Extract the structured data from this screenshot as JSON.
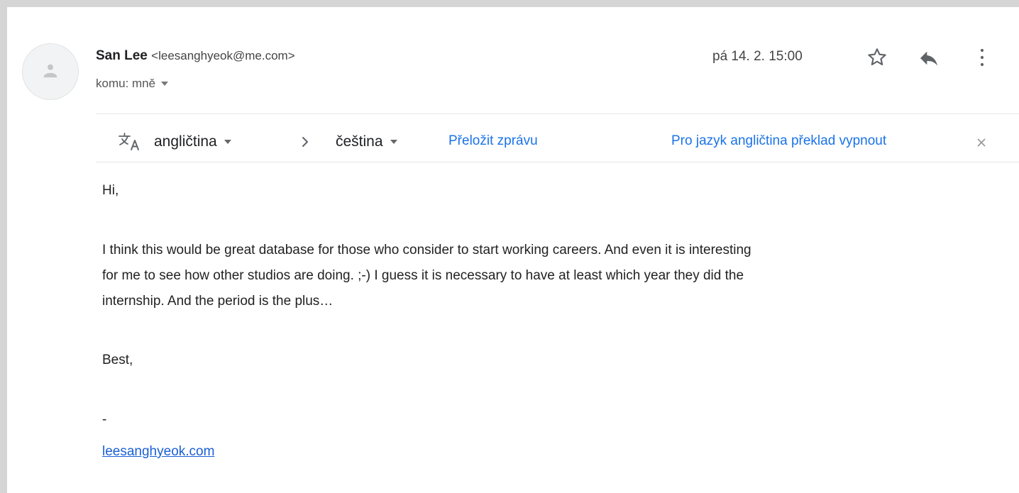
{
  "sender": {
    "name": "San Lee",
    "email": "<leesanghyeok@me.com>"
  },
  "recipient": {
    "label": "komu: mně"
  },
  "date": "pá 14. 2. 15:00",
  "icons": {
    "avatar": "person-icon",
    "star": "star-icon",
    "reply": "reply-icon",
    "more": "more-vert-icon",
    "translate": "translate-icon",
    "chevron": "chevron-right-icon",
    "close": "close-icon"
  },
  "translate_bar": {
    "source_language": "angličtina",
    "target_language": "čeština",
    "translate_link": "Přeložit zprávu",
    "turn_off_link": "Pro jazyk angličtina překlad vypnout"
  },
  "message": {
    "greeting": "Hi,",
    "paragraph_lines": [
      "I think this would be great database for those who consider to start working careers. And even it is interesting",
      "for me to see how other studios are doing. ;-) I guess it is necessary to have at least which year they did the",
      "internship. And the period is the plus…"
    ],
    "closing": "Best,",
    "signature_dash": "-",
    "signature_link": "leesanghyeok.com"
  },
  "colors": {
    "page_background": "#d5d5d5",
    "card_background": "#ffffff",
    "link_blue": "#1a73e8",
    "signature_link": "#1a5fd6",
    "icon_gray": "#5f6368"
  }
}
